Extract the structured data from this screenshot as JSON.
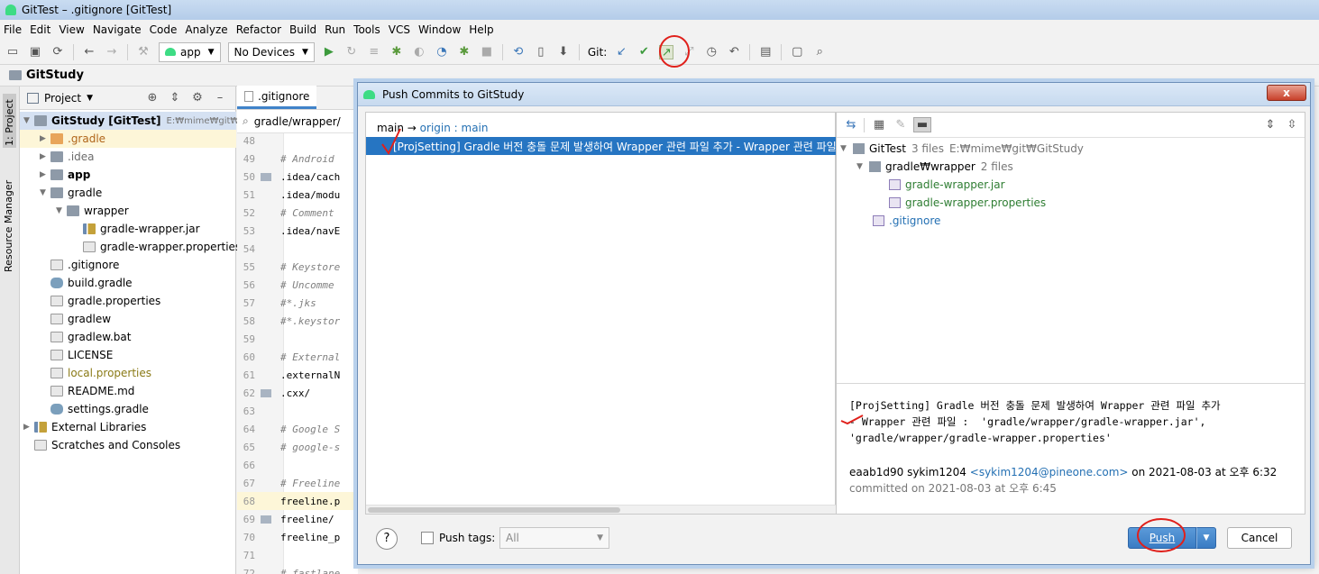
{
  "window": {
    "title": "GitTest – .gitignore [GitTest]"
  },
  "menu": [
    "File",
    "Edit",
    "View",
    "Navigate",
    "Code",
    "Analyze",
    "Refactor",
    "Build",
    "Run",
    "Tools",
    "VCS",
    "Window",
    "Help"
  ],
  "toolbar": {
    "run_config": "app",
    "device": "No Devices",
    "git_label": "Git:",
    "icons": [
      "open-icon",
      "save-icon",
      "sync-icon",
      "back-icon",
      "forward-icon",
      "hammer-icon",
      "run-icon",
      "rerun-icon",
      "coverage-icon",
      "debug-icon",
      "attach-icon",
      "profile-icon",
      "apply-changes-icon",
      "stop-icon",
      "gradle-sync-icon",
      "avd-manager-icon",
      "sdk-manager-icon",
      "git-update-icon",
      "git-commit-icon",
      "git-push-icon",
      "git-branch-icon",
      "history-icon",
      "rollback-icon",
      "project-structure-icon",
      "terminal-icon",
      "search-icon"
    ]
  },
  "breadcrumb": "GitStudy",
  "left_strip": {
    "project_tab": "1: Project",
    "resource_tab": "Resource Manager"
  },
  "project_panel": {
    "title": "Project",
    "root": "GitStudy [GitTest]",
    "root_path": "E:₩mime₩git₩Git",
    "items": [
      {
        "label": ".gradle",
        "type": "folder-orange",
        "depth": 1,
        "expandable": true,
        "style": "orange"
      },
      {
        "label": ".idea",
        "type": "folder",
        "depth": 1,
        "expandable": true,
        "style": "muted"
      },
      {
        "label": "app",
        "type": "folder",
        "depth": 1,
        "expandable": true,
        "style": "bold"
      },
      {
        "label": "gradle",
        "type": "folder",
        "depth": 1,
        "expandable": true,
        "expanded": true
      },
      {
        "label": "wrapper",
        "type": "folder",
        "depth": 2,
        "expandable": true,
        "expanded": true
      },
      {
        "label": "gradle-wrapper.jar",
        "type": "lib",
        "depth": 3
      },
      {
        "label": "gradle-wrapper.properties",
        "type": "file",
        "depth": 3
      },
      {
        "label": ".gitignore",
        "type": "file",
        "depth": 1
      },
      {
        "label": "build.gradle",
        "type": "gradle",
        "depth": 1
      },
      {
        "label": "gradle.properties",
        "type": "file",
        "depth": 1
      },
      {
        "label": "gradlew",
        "type": "file",
        "depth": 1
      },
      {
        "label": "gradlew.bat",
        "type": "file",
        "depth": 1
      },
      {
        "label": "LICENSE",
        "type": "file",
        "depth": 1
      },
      {
        "label": "local.properties",
        "type": "file",
        "depth": 1,
        "style": "olive"
      },
      {
        "label": "README.md",
        "type": "file",
        "depth": 1
      },
      {
        "label": "settings.gradle",
        "type": "gradle",
        "depth": 1
      }
    ],
    "external": "External Libraries",
    "scratches": "Scratches and Consoles"
  },
  "editor": {
    "tab": ".gitignore",
    "search": "gradle/wrapper/",
    "lines": [
      {
        "n": "48",
        "text": "",
        "fold": false
      },
      {
        "n": "49",
        "text": "# Android",
        "comment": true
      },
      {
        "n": "50",
        "text": ".idea/cach",
        "fold": true
      },
      {
        "n": "51",
        "text": ".idea/modu"
      },
      {
        "n": "52",
        "text": "# Comment",
        "comment": true
      },
      {
        "n": "53",
        "text": ".idea/navE"
      },
      {
        "n": "54",
        "text": ""
      },
      {
        "n": "55",
        "text": "# Keystore",
        "comment": true
      },
      {
        "n": "56",
        "text": "# Uncomme",
        "comment": true
      },
      {
        "n": "57",
        "text": "#*.jks",
        "comment": true
      },
      {
        "n": "58",
        "text": "#*.keystor",
        "comment": true
      },
      {
        "n": "59",
        "text": ""
      },
      {
        "n": "60",
        "text": "# External",
        "comment": true
      },
      {
        "n": "61",
        "text": ".externalN"
      },
      {
        "n": "62",
        "text": ".cxx/",
        "fold": true
      },
      {
        "n": "63",
        "text": ""
      },
      {
        "n": "64",
        "text": "# Google S",
        "comment": true
      },
      {
        "n": "65",
        "text": "# google-s",
        "comment": true
      },
      {
        "n": "66",
        "text": ""
      },
      {
        "n": "67",
        "text": "# Freeline",
        "comment": true
      },
      {
        "n": "68",
        "text": "freeline.p",
        "current": true
      },
      {
        "n": "69",
        "text": "freeline/",
        "fold": true
      },
      {
        "n": "70",
        "text": "freeline_p"
      },
      {
        "n": "71",
        "text": ""
      },
      {
        "n": "72",
        "text": "# fastlane",
        "comment": true
      }
    ]
  },
  "dialog": {
    "title": "Push Commits to GitStudy",
    "close": "x",
    "branch_local": "main",
    "branch_arrow": " → ",
    "branch_remote": "origin",
    "branch_sep": " : ",
    "branch_target": "main",
    "commit": "[ProjSetting] Gradle 버전 충돌 문제 발생하여 Wrapper 관련 파일 추가 - Wrapper 관련 파일",
    "files": {
      "root": "GitTest",
      "root_count": "3 files",
      "root_path": "E:₩mime₩git₩GitStudy",
      "dir": "gradle₩wrapper",
      "dir_count": "2 files",
      "file1": "gradle-wrapper.jar",
      "file2": "gradle-wrapper.properties",
      "file3": ".gitignore"
    },
    "message": "[ProjSetting] Gradle 버전 충돌 문제 발생하여 Wrapper 관련 파일 추가\n- Wrapper 관련 파일 :  'gradle/wrapper/gradle-wrapper.jar',\n'gradle/wrapper/gradle-wrapper.properties'",
    "hash": "eaab1d90",
    "author": "sykim1204",
    "email": "<sykim1204@pineone.com>",
    "authored_on": "on 2021-08-03 at 오후 6:32",
    "committed": "committed on 2021-08-03 at 오후 6:45",
    "help": "?",
    "push_tags_label": "Push tags:",
    "push_tags_value": "All",
    "push_button": "Push",
    "cancel_button": "Cancel"
  },
  "colors": {
    "selection": "#2675c2",
    "accent": "#3a7cc4",
    "annotation": "#e0201b",
    "added_file": "#2e7d32"
  }
}
